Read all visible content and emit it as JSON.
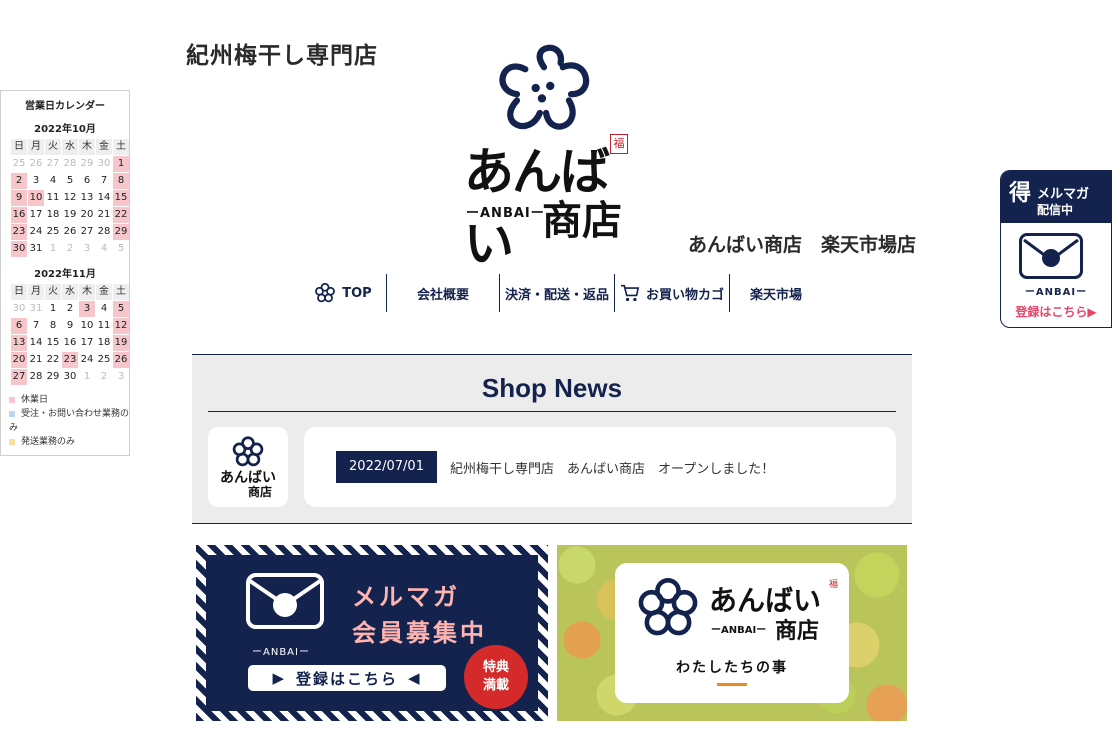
{
  "header": {
    "tagline": "紀州梅干し専門店",
    "logo_name": "あんばい",
    "logo_stamp": "福",
    "logo_sub": "ーANBAIー",
    "logo_shop": "商店",
    "store_name": "あんばい商店　楽天市場店"
  },
  "nav": {
    "items": [
      {
        "label": "TOP",
        "icon": "plum-flower-icon"
      },
      {
        "label": "会社概要"
      },
      {
        "label": "決済・配送・返品"
      },
      {
        "label": "お買い物カゴ",
        "icon": "cart-icon"
      },
      {
        "label": "楽天市場"
      }
    ]
  },
  "calendar": {
    "title": "営業日カレンダー",
    "weekdays": [
      "日",
      "月",
      "火",
      "水",
      "木",
      "金",
      "土"
    ],
    "months": [
      {
        "label": "2022年10月",
        "days": [
          {
            "d": "25",
            "t": "out"
          },
          {
            "d": "26",
            "t": "out"
          },
          {
            "d": "27",
            "t": "out"
          },
          {
            "d": "28",
            "t": "out"
          },
          {
            "d": "29",
            "t": "out"
          },
          {
            "d": "30",
            "t": "out"
          },
          {
            "d": "1",
            "t": "hol"
          },
          {
            "d": "2",
            "t": "hol"
          },
          {
            "d": "3"
          },
          {
            "d": "4"
          },
          {
            "d": "5"
          },
          {
            "d": "6"
          },
          {
            "d": "7"
          },
          {
            "d": "8",
            "t": "hol"
          },
          {
            "d": "9",
            "t": "hol"
          },
          {
            "d": "10",
            "t": "hol"
          },
          {
            "d": "11"
          },
          {
            "d": "12"
          },
          {
            "d": "13"
          },
          {
            "d": "14"
          },
          {
            "d": "15",
            "t": "hol"
          },
          {
            "d": "16",
            "t": "hol"
          },
          {
            "d": "17"
          },
          {
            "d": "18"
          },
          {
            "d": "19"
          },
          {
            "d": "20"
          },
          {
            "d": "21"
          },
          {
            "d": "22",
            "t": "hol"
          },
          {
            "d": "23",
            "t": "hol"
          },
          {
            "d": "24"
          },
          {
            "d": "25"
          },
          {
            "d": "26"
          },
          {
            "d": "27"
          },
          {
            "d": "28"
          },
          {
            "d": "29",
            "t": "hol"
          },
          {
            "d": "30",
            "t": "hol"
          },
          {
            "d": "31"
          },
          {
            "d": "1",
            "t": "out"
          },
          {
            "d": "2",
            "t": "out"
          },
          {
            "d": "3",
            "t": "out"
          },
          {
            "d": "4",
            "t": "out"
          },
          {
            "d": "5",
            "t": "out"
          }
        ]
      },
      {
        "label": "2022年11月",
        "days": [
          {
            "d": "30",
            "t": "out"
          },
          {
            "d": "31",
            "t": "out"
          },
          {
            "d": "1"
          },
          {
            "d": "2"
          },
          {
            "d": "3",
            "t": "hol"
          },
          {
            "d": "4"
          },
          {
            "d": "5",
            "t": "hol"
          },
          {
            "d": "6",
            "t": "hol"
          },
          {
            "d": "7"
          },
          {
            "d": "8"
          },
          {
            "d": "9"
          },
          {
            "d": "10"
          },
          {
            "d": "11"
          },
          {
            "d": "12",
            "t": "hol"
          },
          {
            "d": "13",
            "t": "hol"
          },
          {
            "d": "14"
          },
          {
            "d": "15"
          },
          {
            "d": "16"
          },
          {
            "d": "17"
          },
          {
            "d": "18"
          },
          {
            "d": "19",
            "t": "hol"
          },
          {
            "d": "20",
            "t": "hol"
          },
          {
            "d": "21"
          },
          {
            "d": "22"
          },
          {
            "d": "23",
            "t": "hol"
          },
          {
            "d": "24"
          },
          {
            "d": "25"
          },
          {
            "d": "26",
            "t": "hol"
          },
          {
            "d": "27",
            "t": "hol"
          },
          {
            "d": "28"
          },
          {
            "d": "29"
          },
          {
            "d": "30"
          },
          {
            "d": "1",
            "t": "out"
          },
          {
            "d": "2",
            "t": "out"
          },
          {
            "d": "3",
            "t": "out"
          }
        ]
      }
    ],
    "legend": [
      {
        "label": "休業日",
        "color": "#f6c6cb"
      },
      {
        "label": "受注・お問い合わせ業務のみ",
        "color": "#bcd7f2"
      },
      {
        "label": "発送業務のみ",
        "color": "#f9dfa0"
      }
    ]
  },
  "news": {
    "title": "Shop News",
    "items": [
      {
        "date": "2022/07/01",
        "text": "紀州梅干し専門店　あんばい商店　オープンしました！"
      }
    ],
    "logo_name": "あんばい",
    "logo_shop": "商店"
  },
  "banners": {
    "mail": {
      "title1": "メルマガ",
      "title2": "会員募集中",
      "anbai": "ーANBAIー",
      "button": "登録はこちら",
      "badge1": "特典",
      "badge2": "満載"
    },
    "about": {
      "logo_name": "あんばい",
      "logo_sub": "ーANBAIー",
      "logo_shop": "商店",
      "stamp": "福",
      "text": "わたしたちの事"
    }
  },
  "widget": {
    "toku": "得",
    "line1": "メルマガ",
    "line2": "配信中",
    "anbai": "ーANBAIー",
    "link": "登録はこちら▶"
  },
  "colors": {
    "navy": "#14234e",
    "holiday": "#f6c6cb",
    "accent_pink": "#e8466b",
    "badge_red": "#d52a2a"
  }
}
